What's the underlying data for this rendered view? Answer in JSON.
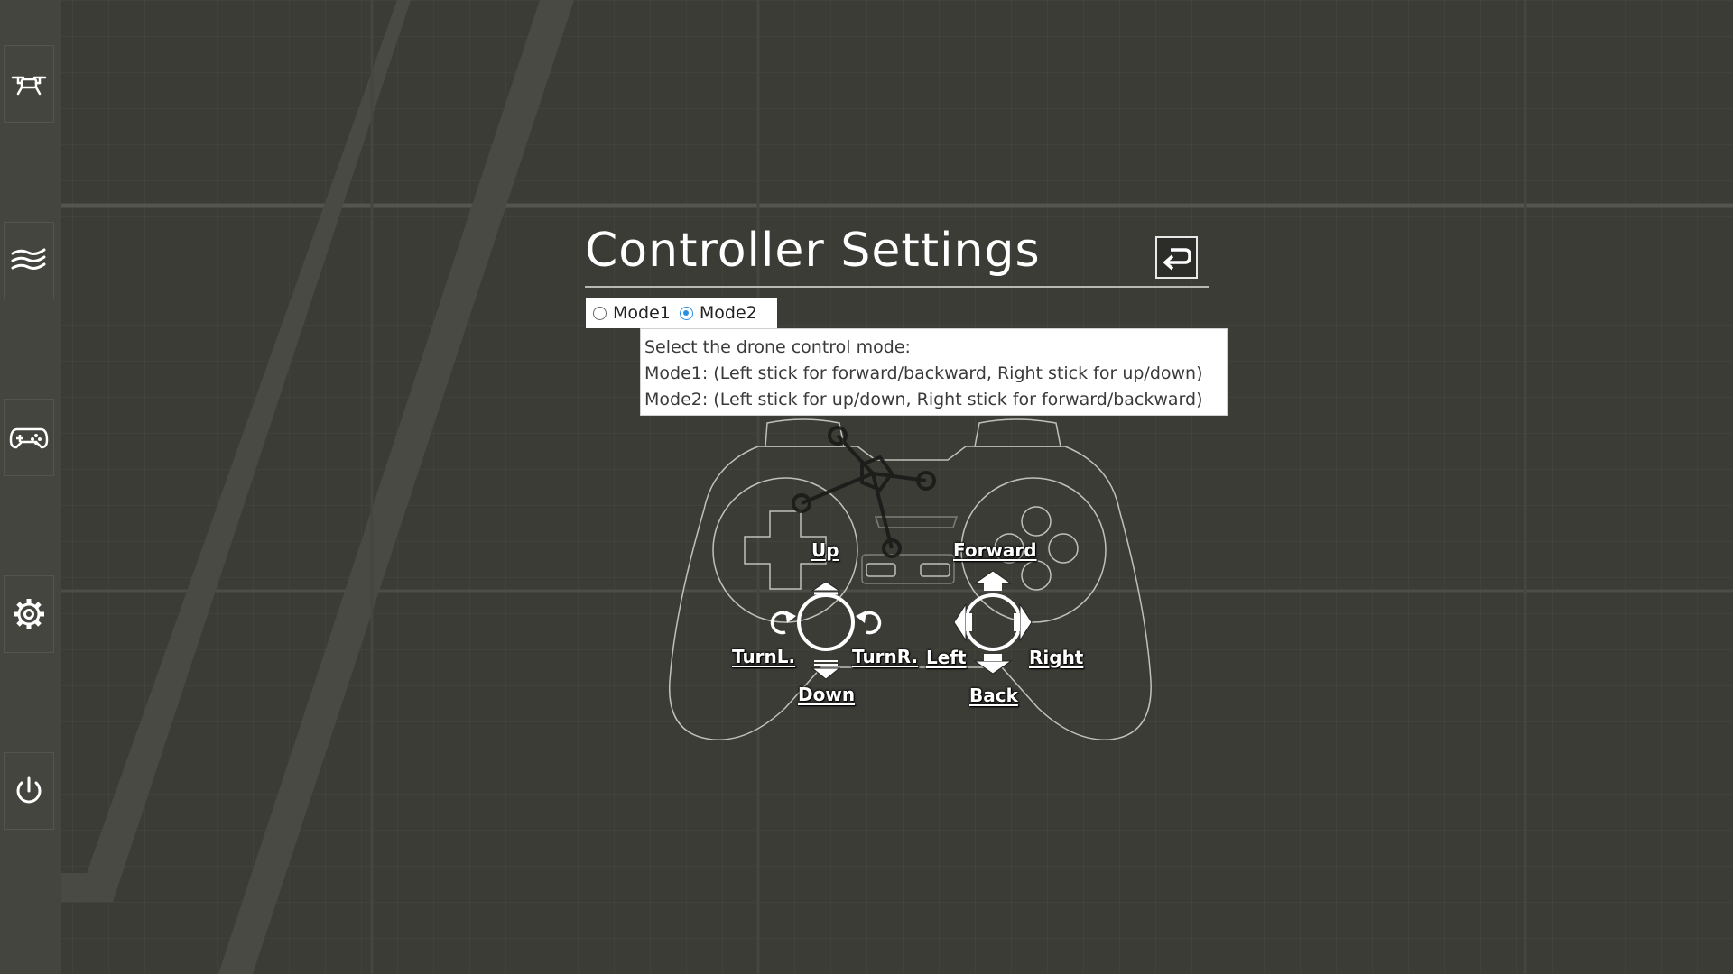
{
  "sidebar": {
    "items": [
      {
        "name": "drone",
        "icon": "drone-icon"
      },
      {
        "name": "wind",
        "icon": "wind-icon"
      },
      {
        "name": "controller",
        "icon": "gamepad-icon"
      },
      {
        "name": "settings",
        "icon": "gear-icon"
      },
      {
        "name": "power",
        "icon": "power-icon"
      }
    ]
  },
  "settings": {
    "title": "Controller Settings",
    "back_icon": "return-arrow-icon",
    "modes": [
      {
        "label": "Mode1",
        "selected": false
      },
      {
        "label": "Mode2",
        "selected": true
      }
    ],
    "tooltip": {
      "line1": "Select the drone control mode:",
      "line2": "Mode1: (Left stick for forward/backward, Right stick for up/down)",
      "line3": "Mode2: (Left stick for up/down, Right stick for forward/backward)"
    }
  },
  "controls": {
    "left_stick": {
      "up": "Up",
      "down": "Down",
      "turn_left": "TurnL.",
      "turn_right": "TurnR."
    },
    "right_stick": {
      "forward": "Forward",
      "back": "Back",
      "left": "Left",
      "right": "Right"
    }
  },
  "colors": {
    "background": "#3c3c37",
    "sidebar": "#45453f",
    "accent": "#2b8fe0"
  }
}
